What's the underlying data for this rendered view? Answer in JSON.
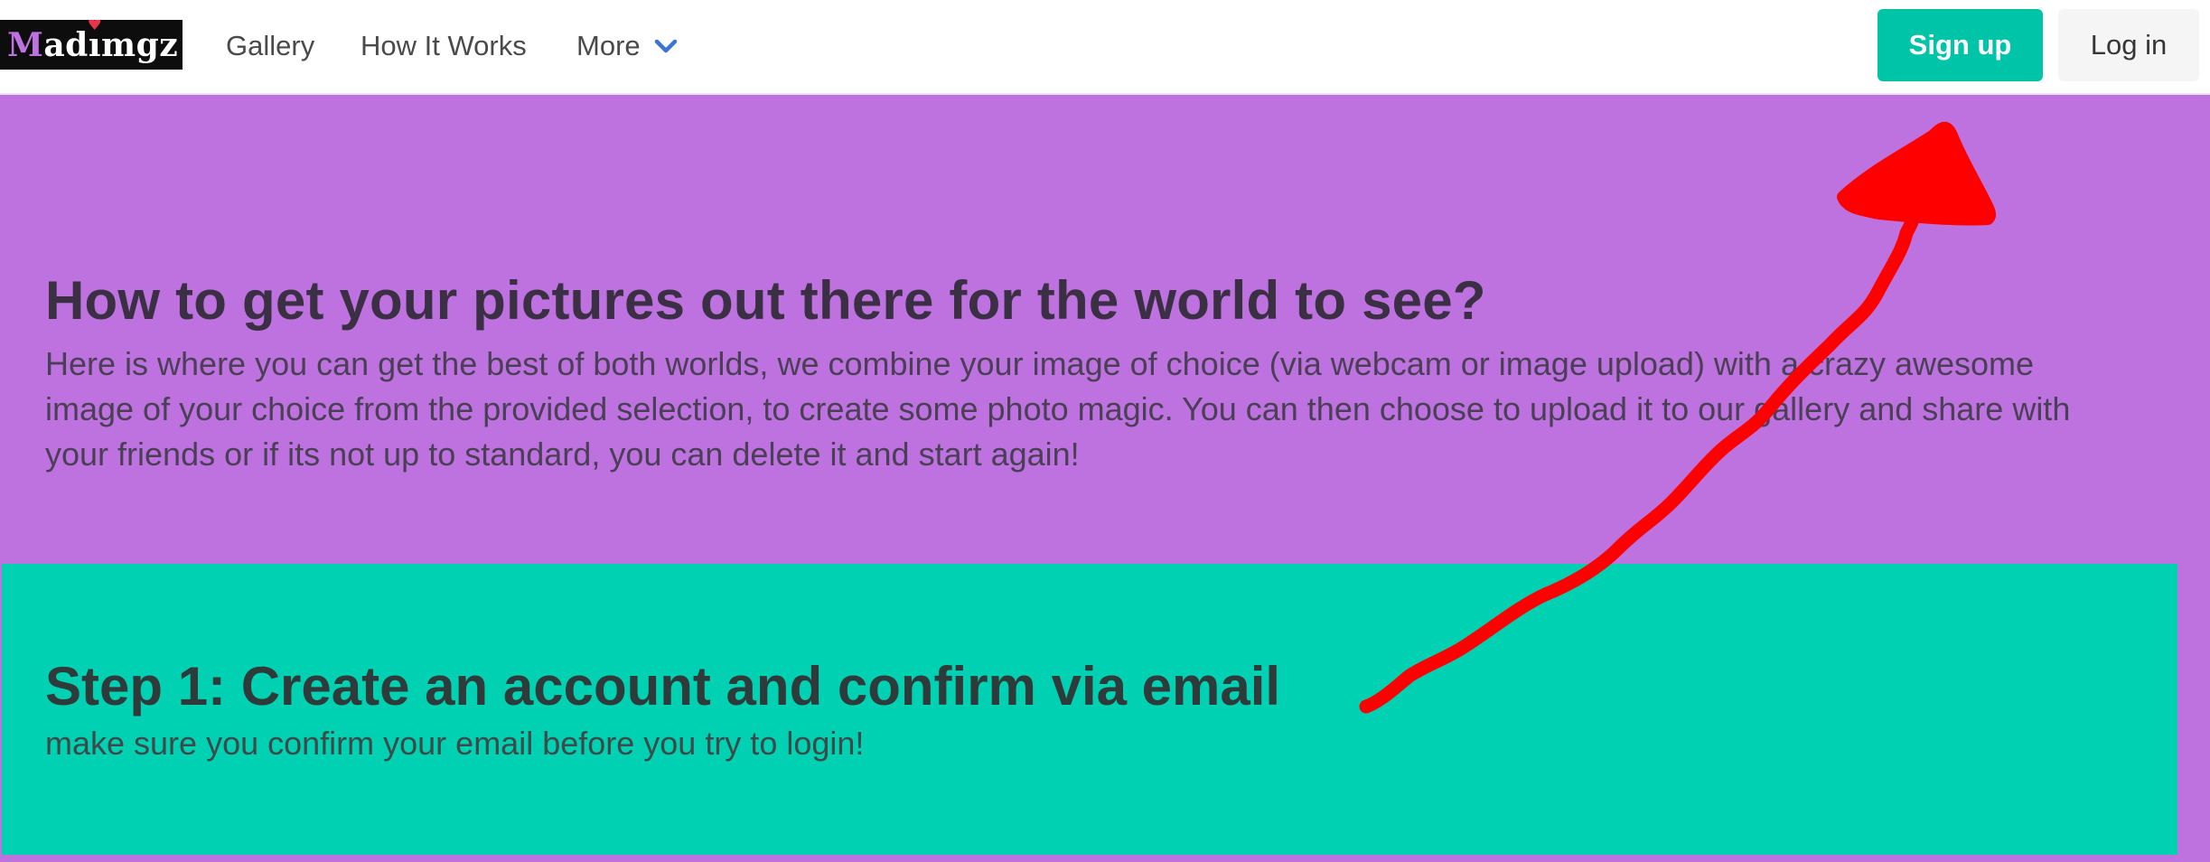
{
  "navbar": {
    "logo": {
      "part1": "M",
      "part2": "ad",
      "part3": "mgz",
      "heart_char": "♥"
    },
    "links": {
      "gallery": "Gallery",
      "how_it_works": "How It Works",
      "more": "More"
    },
    "buttons": {
      "signup": "Sign up",
      "login": "Log in"
    }
  },
  "hero": {
    "title": "How to get your pictures out there for the world to see?",
    "text": "Here is where you can get the best of both worlds, we combine your image of choice (via webcam or image upload) with a crazy awesome image of your choice from the provided selection, to create some photo magic. You can then choose to upload it to our gallery and share with your friends or if its not up to standard, you can delete it and start again!"
  },
  "step1": {
    "title": "Step 1: Create an account and confirm via email",
    "text": "make sure you confirm your email before you try to login!"
  },
  "colors": {
    "primary": "#00d1b2",
    "signup": "#00c4a7",
    "hero_bg": "#bd72e0",
    "annotation": "#ff0000",
    "chevron": "#3e73d6"
  },
  "icons": {
    "more_chevron": "chevron-down-icon"
  }
}
